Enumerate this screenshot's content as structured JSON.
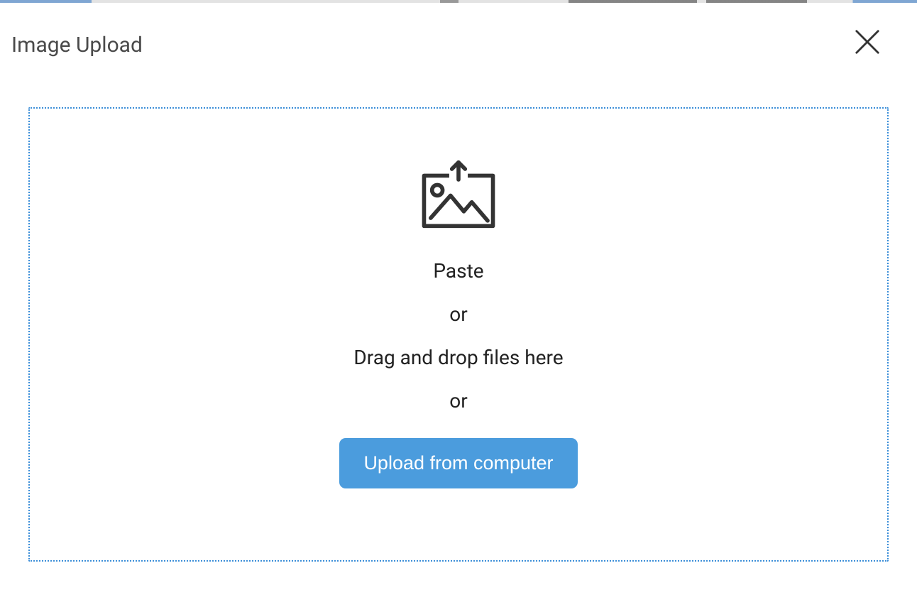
{
  "modal": {
    "title": "Image Upload",
    "dropzone": {
      "paste": "Paste",
      "or1": "or",
      "dragdrop": "Drag and drop files here",
      "or2": "or",
      "upload_button": "Upload from computer"
    }
  }
}
